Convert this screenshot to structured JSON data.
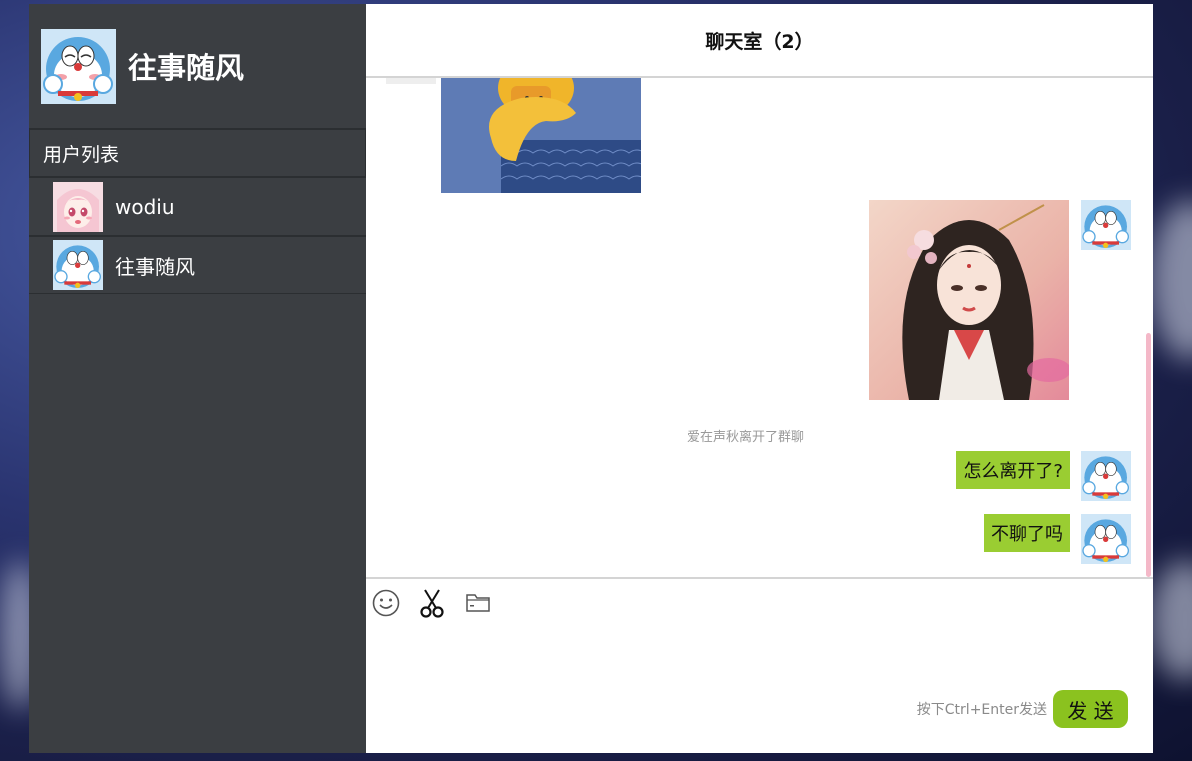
{
  "me": {
    "name": "往事随风",
    "avatar": "doraemon-avatar"
  },
  "sidebar": {
    "title": "用户列表",
    "users": [
      {
        "name": "wodiu",
        "avatar": "anime-girl-avatar"
      },
      {
        "name": "往事随风",
        "avatar": "doraemon-avatar"
      }
    ]
  },
  "chat": {
    "title": "聊天室（2）",
    "messages": [
      {
        "type": "image",
        "from": "other",
        "content": "yellow-duck-image"
      },
      {
        "type": "image",
        "from": "me",
        "content": "painted-woman-image"
      },
      {
        "type": "system",
        "text": "爱在声秋离开了群聊"
      },
      {
        "type": "text",
        "from": "me",
        "text": "怎么离开了?"
      },
      {
        "type": "text",
        "from": "me",
        "text": "不聊了吗"
      }
    ]
  },
  "toolbar": {
    "icons": [
      "smile-icon",
      "scissors-icon",
      "folder-icon"
    ]
  },
  "composer": {
    "hint": "按下Ctrl+Enter发送",
    "send_label": "发 送"
  },
  "colors": {
    "sidebar_bg": "#3b3e42",
    "bubble": "#9acd32",
    "send_button": "#8bc21f"
  }
}
